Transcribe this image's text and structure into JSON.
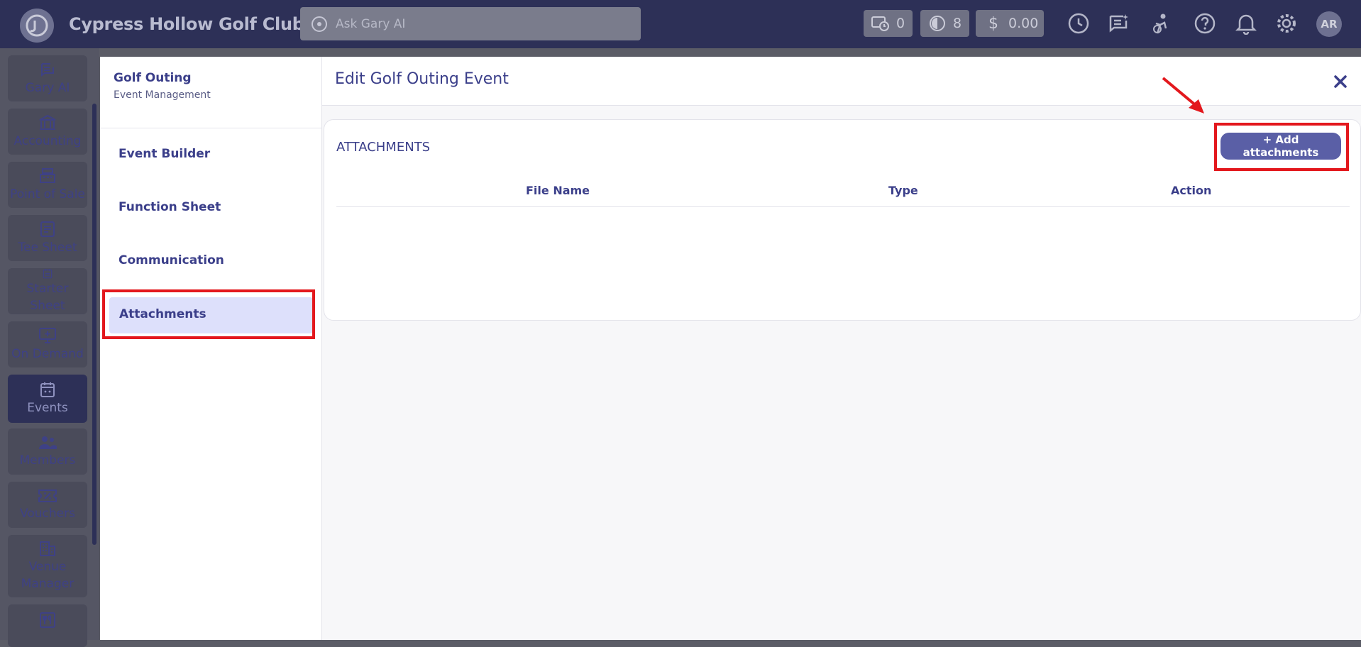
{
  "topbar": {
    "club_name": "Cypress Hollow Golf Club",
    "ask_placeholder": "Ask Gary AI",
    "chips": [
      {
        "icon": "tee-time-clock-icon",
        "value": "0"
      },
      {
        "icon": "pie-chart-icon",
        "value": "8"
      },
      {
        "icon": "dollar-icon",
        "value": "0.00"
      }
    ],
    "avatar_initials": "AR"
  },
  "rail": {
    "items": [
      {
        "label": "Gary AI",
        "icon": "gary-ai-icon"
      },
      {
        "label": "Accounting",
        "icon": "bank-icon"
      },
      {
        "label": "Point of Sale",
        "icon": "cash-register-icon"
      },
      {
        "label": "Tee Sheet",
        "icon": "sheet-icon"
      },
      {
        "label": "Starter Sheet",
        "icon": "calendar-list-icon"
      },
      {
        "label": "On Demand",
        "icon": "monitor-icon"
      },
      {
        "label": "Events",
        "icon": "calendar-icon"
      },
      {
        "label": "Members",
        "icon": "members-icon"
      },
      {
        "label": "Vouchers",
        "icon": "voucher-icon"
      },
      {
        "label": "Venue Manager",
        "icon": "building-icon"
      }
    ],
    "active": "Events"
  },
  "side_panel": {
    "title": "Golf Outing",
    "subtitle": "Event Management",
    "items": [
      "Event Builder",
      "Function Sheet",
      "Communication",
      "Attachments"
    ],
    "active": "Attachments"
  },
  "main": {
    "title": "Edit Golf Outing Event",
    "section_title": "ATTACHMENTS",
    "add_button_label": "+ Add attachments",
    "columns": [
      "File Name",
      "Type",
      "Action"
    ]
  },
  "colors": {
    "accent": "#5a5fa6",
    "highlight": "#e3181d",
    "topbar": "#2d3057"
  }
}
